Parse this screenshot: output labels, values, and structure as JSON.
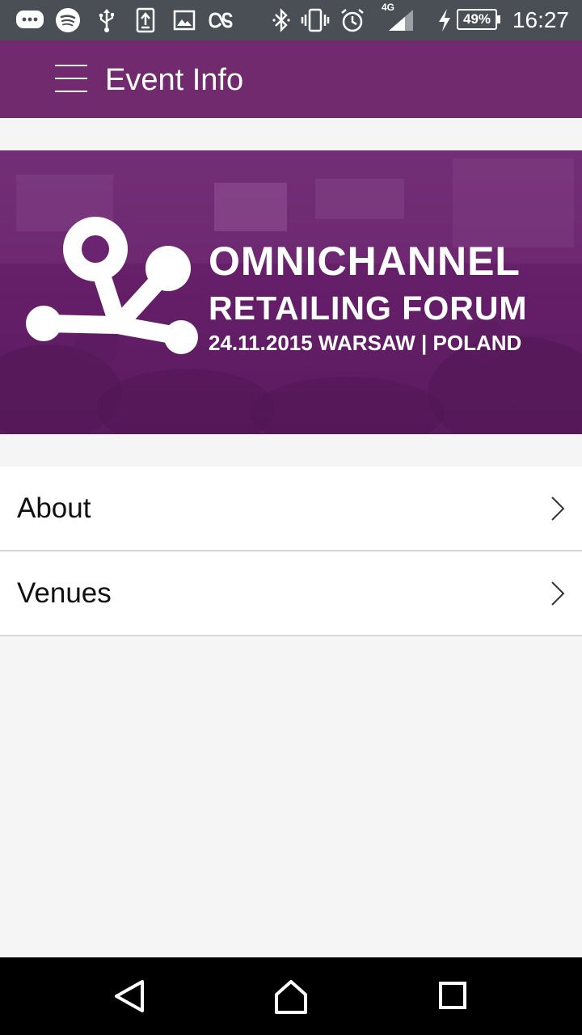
{
  "status_bar": {
    "time": "16:27",
    "battery": "49%",
    "network": "4G",
    "icons": [
      "message-icon",
      "spotify-icon",
      "usb-icon",
      "upload-icon",
      "image-icon",
      "lastfm-icon",
      "bluetooth-icon",
      "vibrate-icon",
      "alarm-icon",
      "signal-icon",
      "charging-icon",
      "battery-icon"
    ]
  },
  "app_bar": {
    "title": "Event Info",
    "menu_icon": "hamburger-menu-icon",
    "color": "#722a6e"
  },
  "banner": {
    "line1": "OMNICHANNEL",
    "line2": "RETAILING FORUM",
    "line3": "24.11.2015 WARSAW | POLAND"
  },
  "menu": {
    "items": [
      {
        "label": "About",
        "icon": "chevron-right-icon"
      },
      {
        "label": "Venues",
        "icon": "chevron-right-icon"
      }
    ]
  },
  "nav_bar": {
    "icons": [
      "back-icon",
      "home-icon",
      "recents-icon"
    ]
  }
}
